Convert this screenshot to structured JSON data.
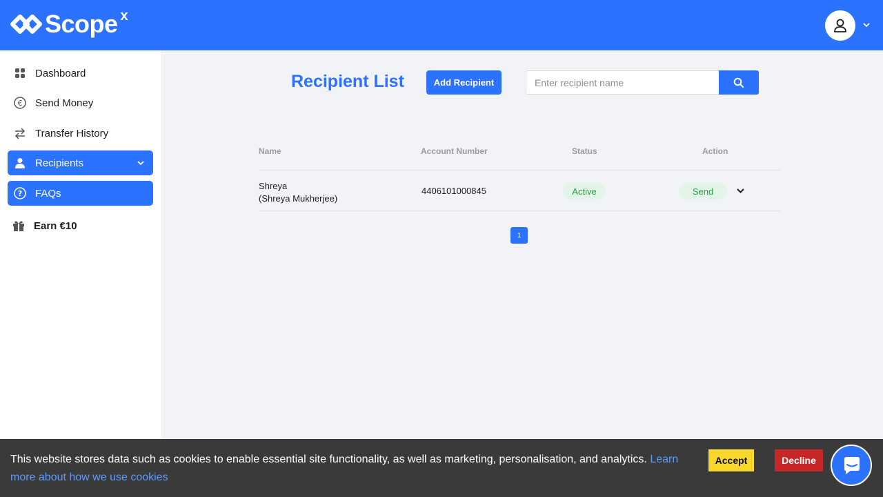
{
  "brand": {
    "name": "Scope",
    "superscript": "x"
  },
  "colors": {
    "primary": "#2b72ff",
    "success": "#24a148",
    "accept": "#f8d72c",
    "decline": "#c62828"
  },
  "sidebar": {
    "items": [
      {
        "label": "Dashboard",
        "icon": "grid-icon",
        "active": false
      },
      {
        "label": "Send Money",
        "icon": "euro-icon",
        "active": false
      },
      {
        "label": "Transfer History",
        "icon": "arrows-icon",
        "active": false
      },
      {
        "label": "Recipients",
        "icon": "user-icon",
        "active": true
      },
      {
        "label": "FAQs",
        "icon": "question-icon",
        "active": true
      },
      {
        "label": "Earn €10",
        "icon": "gift-icon",
        "active": false
      }
    ]
  },
  "main": {
    "title": "Recipient List",
    "add_button": "Add Recipient",
    "search": {
      "placeholder": "Enter recipient name",
      "value": ""
    },
    "table": {
      "headers": [
        "Name",
        "Account Number",
        "Status",
        "Action"
      ],
      "rows": [
        {
          "name": "Shreya",
          "full_name": "(Shreya Mukherjee)",
          "account": "4406101000845",
          "status": "Active",
          "action": "Send"
        }
      ]
    },
    "pagination": {
      "current": "1"
    }
  },
  "cookie_banner": {
    "text": "This website stores data such as cookies to enable essential site functionality, as well as marketing, personalisation, and analytics.",
    "link": "Learn more about how we use cookies",
    "accept": "Accept",
    "decline": "Decline"
  }
}
